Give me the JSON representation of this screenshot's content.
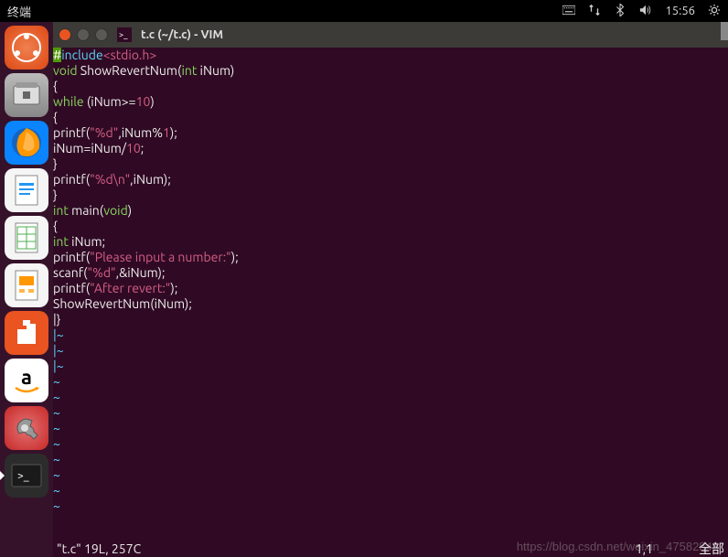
{
  "topbar": {
    "title": "终端",
    "time": "15:56"
  },
  "launcher": {
    "items": [
      {
        "name": "dash-icon"
      },
      {
        "name": "files-icon"
      },
      {
        "name": "firefox-icon"
      },
      {
        "name": "writer-icon"
      },
      {
        "name": "calc-icon"
      },
      {
        "name": "impress-icon"
      },
      {
        "name": "software-icon"
      },
      {
        "name": "amazon-icon"
      },
      {
        "name": "settings-icon"
      },
      {
        "name": "terminal-icon"
      }
    ]
  },
  "window": {
    "title": "t.c (~/t.c) - VIM"
  },
  "code": {
    "l1a": "#",
    "l1b": "include",
    "l1c": "<stdio.h>",
    "l2a": "void",
    "l2b": " ShowRevertNum(",
    "l2c": "int",
    "l2d": " iNum)",
    "l3": "{",
    "l4a": "while",
    "l4b": " (iNum>=",
    "l4c": "10",
    "l4d": ")",
    "l5": "{",
    "l6a": "printf(",
    "l6b": "\"%d\"",
    "l6c": ",iNum%",
    "l6d": "1",
    "l6e": ");",
    "l7a": "iNum=iNum/",
    "l7b": "10",
    "l7c": ";",
    "l8": "}",
    "l9a": "printf(",
    "l9b": "\"%d\\n\"",
    "l9c": ",iNum);",
    "l10": "}",
    "l11a": "int",
    "l11b": " main(",
    "l11c": "void",
    "l11d": ")",
    "l12": "{",
    "l13a": "int",
    "l13b": " iNum;",
    "l14a": "printf(",
    "l14b": "\"Please input a number:\"",
    "l14c": ");",
    "l15a": "scanf(",
    "l15b": "\"%d\"",
    "l15c": ",&iNum);",
    "l16a": "printf(",
    "l16b": "\"After revert:\"",
    "l16c": ");",
    "l17": "ShowRevertNum(iNum);",
    "l18a": "|",
    "l18b": "}",
    "tilde": "~",
    "tilde_pipe": "|~"
  },
  "status": {
    "file": "\"t.c\" 19L, 257C",
    "pos": "1,1",
    "scroll": "全部"
  },
  "watermark": "https://blog.csdn.net/weixin_47582848"
}
